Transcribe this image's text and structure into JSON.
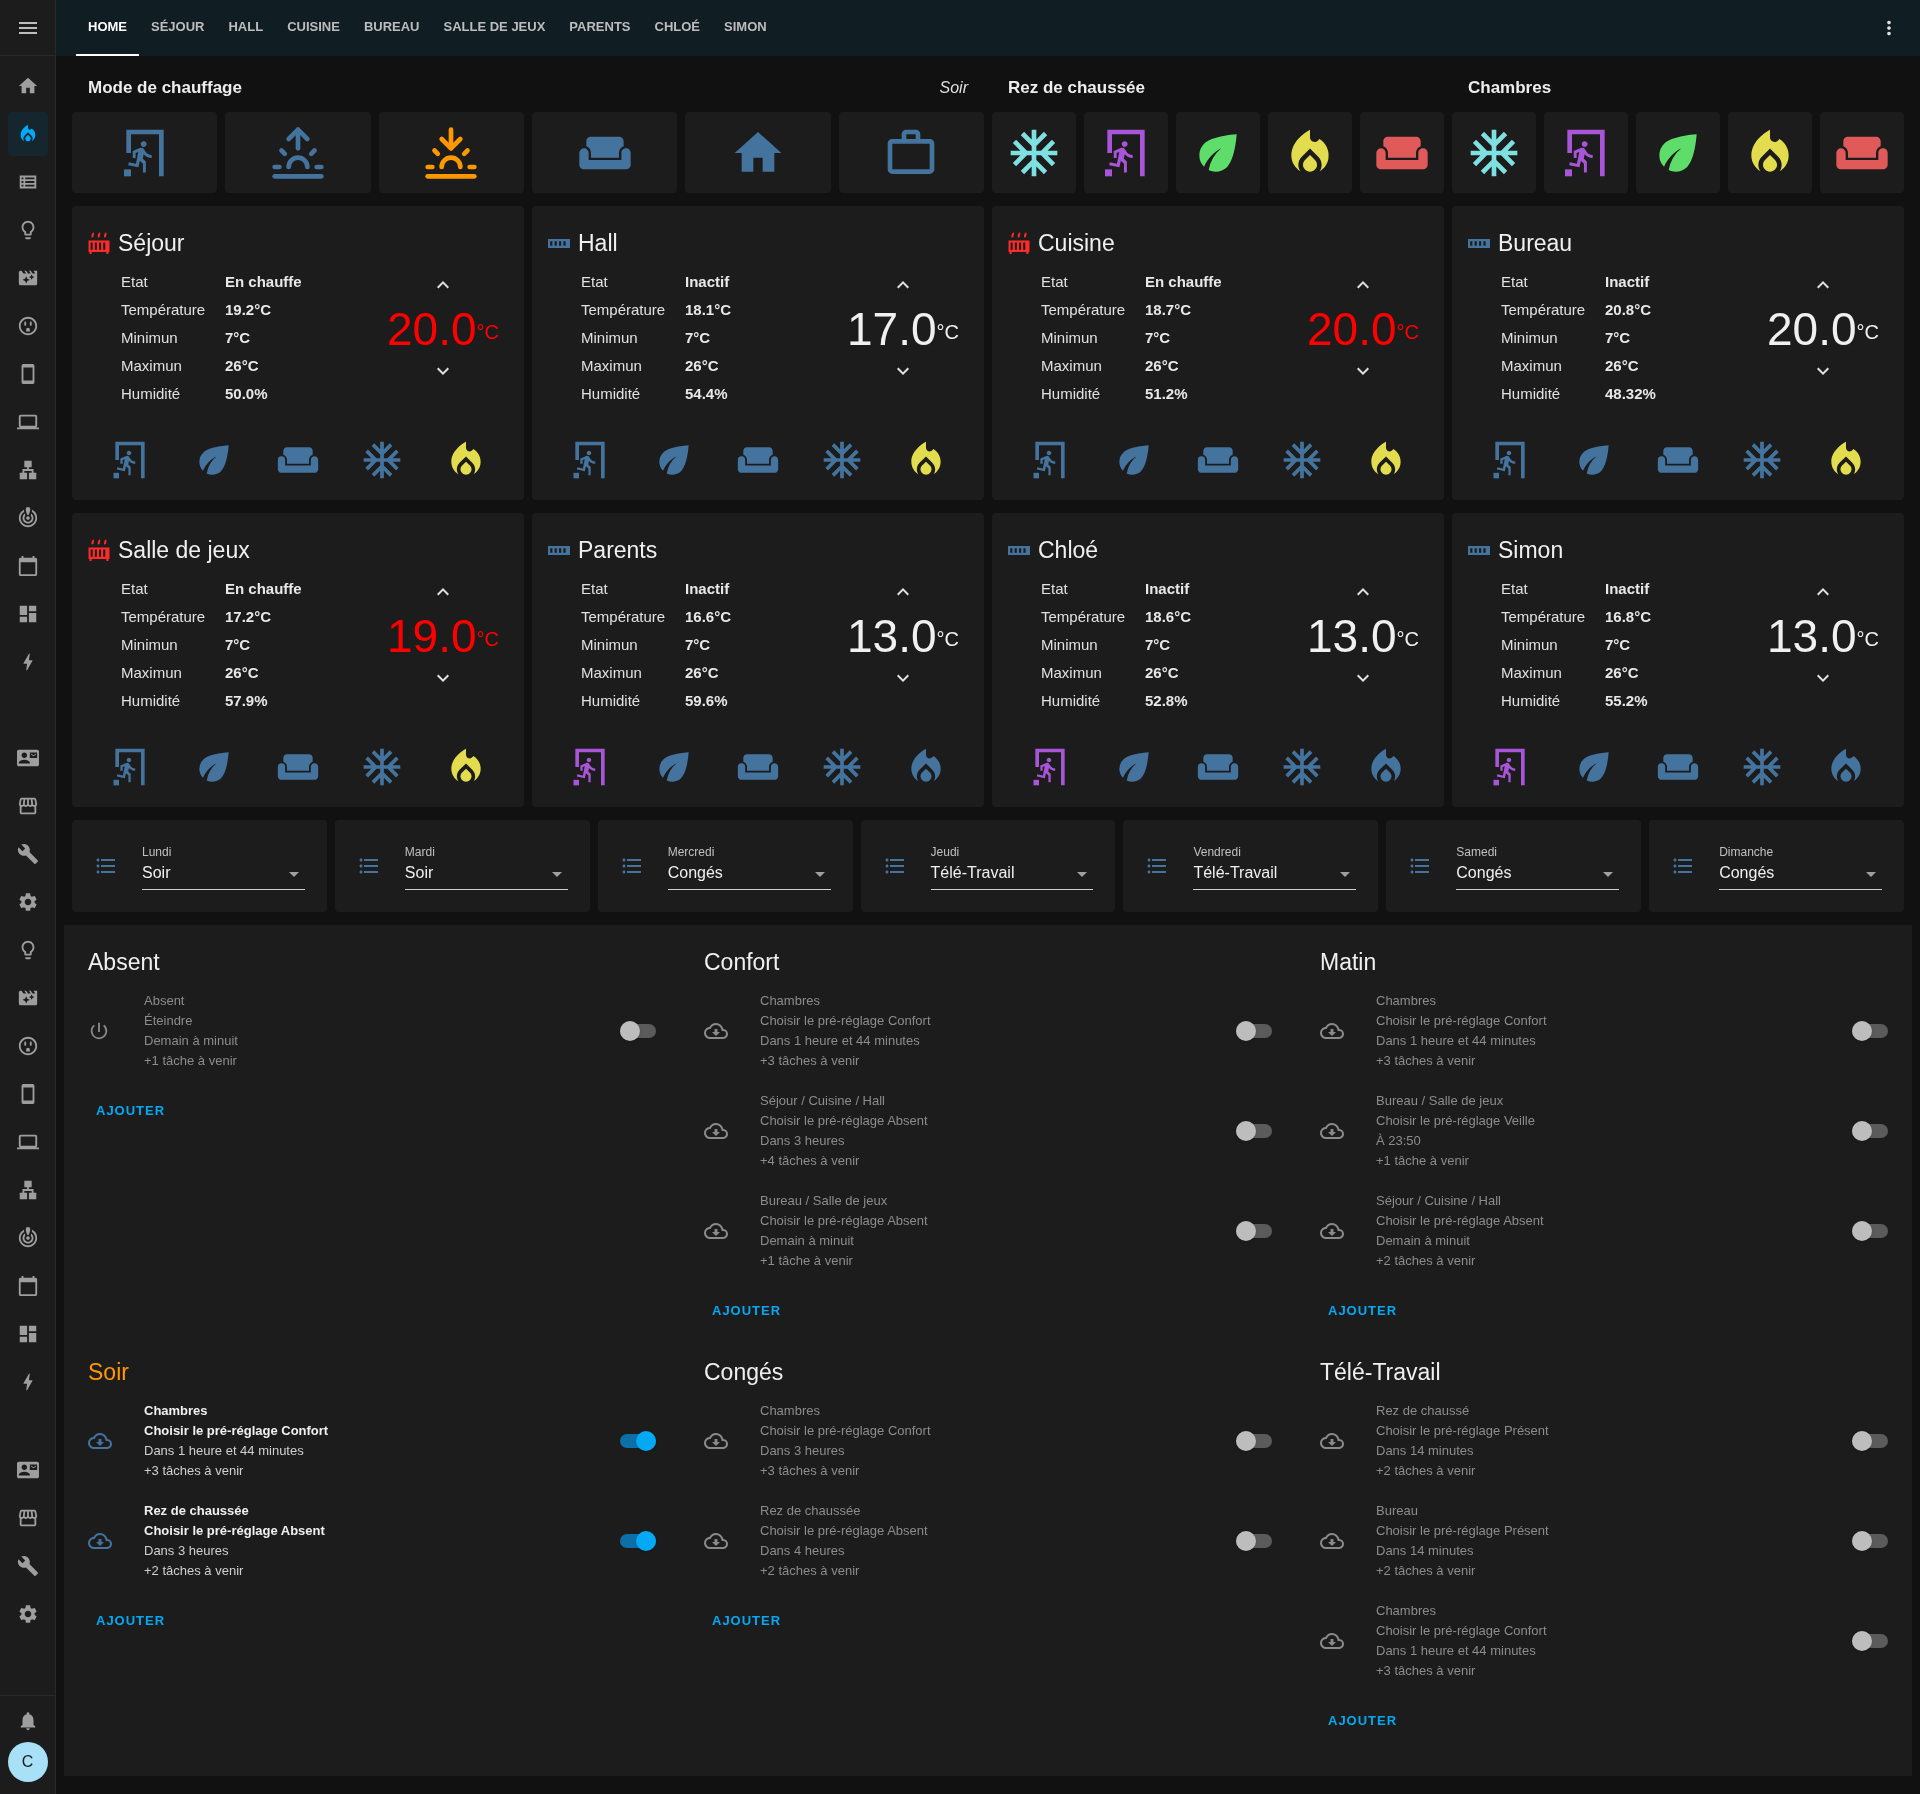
{
  "top_bar": {
    "tabs": [
      {
        "label": "HOME",
        "selected": true
      },
      {
        "label": "SÉJOUR",
        "selected": false
      },
      {
        "label": "HALL",
        "selected": false
      },
      {
        "label": "CUISINE",
        "selected": false
      },
      {
        "label": "BUREAU",
        "selected": false
      },
      {
        "label": "SALLE DE JEUX",
        "selected": false
      },
      {
        "label": "PARENTS",
        "selected": false
      },
      {
        "label": "CHLOÉ",
        "selected": false
      },
      {
        "label": "SIMON",
        "selected": false
      }
    ]
  },
  "sidebar": {
    "sections": [
      {
        "items": [
          {
            "selected": false
          },
          {
            "selected": true
          },
          {
            "selected": false
          },
          {
            "selected": false
          },
          {
            "selected": false
          },
          {
            "selected": false
          },
          {
            "selected": false
          },
          {
            "selected": false
          },
          {
            "selected": false
          },
          {
            "selected": false
          },
          {
            "selected": false
          },
          {
            "selected": false
          },
          {
            "selected": false
          }
        ]
      },
      {
        "items": [
          {
            "selected": false
          },
          {
            "selected": false
          },
          {
            "selected": false
          },
          {
            "selected": false
          },
          {
            "selected": false
          },
          {
            "selected": false
          },
          {
            "selected": false
          },
          {
            "selected": false
          },
          {
            "selected": false
          },
          {
            "selected": false
          },
          {
            "selected": false
          },
          {
            "selected": false
          },
          {
            "selected": false
          },
          {
            "selected": false
          }
        ]
      },
      {
        "items": [
          {
            "selected": false
          },
          {
            "selected": false
          },
          {
            "selected": false
          },
          {
            "selected": false
          }
        ]
      }
    ],
    "avatar": "C"
  },
  "mode_groups": [
    {
      "title": "Mode de chauffage",
      "subtitle": "Soir",
      "buttons": [
        {
          "kind": "away",
          "color": "#44739e"
        },
        {
          "kind": "sun-up",
          "color": "#44739e"
        },
        {
          "kind": "sun-down",
          "color": "#ff9800"
        },
        {
          "kind": "comfort",
          "color": "#44739e"
        },
        {
          "kind": "home",
          "color": "#44739e"
        },
        {
          "kind": "work",
          "color": "#44739e"
        }
      ]
    },
    {
      "title": "Rez de chaussée",
      "buttons": [
        {
          "kind": "frost",
          "color": "#7ee0e0"
        },
        {
          "kind": "away",
          "color": "#a855d8"
        },
        {
          "kind": "eco",
          "color": "#5fdd6b"
        },
        {
          "kind": "heat",
          "color": "#e3dc4f"
        },
        {
          "kind": "comfort",
          "color": "#e05a5a"
        }
      ]
    },
    {
      "title": "Chambres",
      "buttons": [
        {
          "kind": "frost",
          "color": "#7ee0e0"
        },
        {
          "kind": "away",
          "color": "#a855d8"
        },
        {
          "kind": "eco",
          "color": "#5fdd6b"
        },
        {
          "kind": "heat",
          "color": "#e3dc4f"
        },
        {
          "kind": "comfort",
          "color": "#e05a5a"
        }
      ]
    }
  ],
  "thermostats": [
    {
      "name": "Séjour",
      "heating": true,
      "attributes": [
        {
          "label": "Etat",
          "value": "En chauffe"
        },
        {
          "label": "Température",
          "value": "19.2°C"
        },
        {
          "label": "Minimun",
          "value": "7°C"
        },
        {
          "label": "Maximun",
          "value": "26°C"
        },
        {
          "label": "Humidité",
          "value": "50.0%"
        }
      ],
      "target": "20.0",
      "unit": "°C",
      "presets": [
        {
          "kind": "away",
          "color": "#44739e"
        },
        {
          "kind": "eco",
          "color": "#44739e"
        },
        {
          "kind": "comfort",
          "color": "#44739e"
        },
        {
          "kind": "frost",
          "color": "#44739e"
        },
        {
          "kind": "heat",
          "color": "#e3dc4f"
        }
      ]
    },
    {
      "name": "Hall",
      "heating": false,
      "attributes": [
        {
          "label": "Etat",
          "value": "Inactif"
        },
        {
          "label": "Température",
          "value": "18.1°C"
        },
        {
          "label": "Minimun",
          "value": "7°C"
        },
        {
          "label": "Maximun",
          "value": "26°C"
        },
        {
          "label": "Humidité",
          "value": "54.4%"
        }
      ],
      "target": "17.0",
      "unit": "°C",
      "presets": [
        {
          "kind": "away",
          "color": "#44739e"
        },
        {
          "kind": "eco",
          "color": "#44739e"
        },
        {
          "kind": "comfort",
          "color": "#44739e"
        },
        {
          "kind": "frost",
          "color": "#44739e"
        },
        {
          "kind": "heat",
          "color": "#e3dc4f"
        }
      ]
    },
    {
      "name": "Cuisine",
      "heating": true,
      "attributes": [
        {
          "label": "Etat",
          "value": "En chauffe"
        },
        {
          "label": "Température",
          "value": "18.7°C"
        },
        {
          "label": "Minimun",
          "value": "7°C"
        },
        {
          "label": "Maximun",
          "value": "26°C"
        },
        {
          "label": "Humidité",
          "value": "51.2%"
        }
      ],
      "target": "20.0",
      "unit": "°C",
      "presets": [
        {
          "kind": "away",
          "color": "#44739e"
        },
        {
          "kind": "eco",
          "color": "#44739e"
        },
        {
          "kind": "comfort",
          "color": "#44739e"
        },
        {
          "kind": "frost",
          "color": "#44739e"
        },
        {
          "kind": "heat",
          "color": "#e3dc4f"
        }
      ]
    },
    {
      "name": "Bureau",
      "heating": false,
      "attributes": [
        {
          "label": "Etat",
          "value": "Inactif"
        },
        {
          "label": "Température",
          "value": "20.8°C"
        },
        {
          "label": "Minimun",
          "value": "7°C"
        },
        {
          "label": "Maximun",
          "value": "26°C"
        },
        {
          "label": "Humidité",
          "value": "48.32%"
        }
      ],
      "target": "20.0",
      "unit": "°C",
      "presets": [
        {
          "kind": "away",
          "color": "#44739e"
        },
        {
          "kind": "eco",
          "color": "#44739e"
        },
        {
          "kind": "comfort",
          "color": "#44739e"
        },
        {
          "kind": "frost",
          "color": "#44739e"
        },
        {
          "kind": "heat",
          "color": "#e3dc4f"
        }
      ]
    },
    {
      "name": "Salle de jeux",
      "heating": true,
      "attributes": [
        {
          "label": "Etat",
          "value": "En chauffe"
        },
        {
          "label": "Température",
          "value": "17.2°C"
        },
        {
          "label": "Minimun",
          "value": "7°C"
        },
        {
          "label": "Maximun",
          "value": "26°C"
        },
        {
          "label": "Humidité",
          "value": "57.9%"
        }
      ],
      "target": "19.0",
      "unit": "°C",
      "presets": [
        {
          "kind": "away",
          "color": "#44739e"
        },
        {
          "kind": "eco",
          "color": "#44739e"
        },
        {
          "kind": "comfort",
          "color": "#44739e"
        },
        {
          "kind": "frost",
          "color": "#44739e"
        },
        {
          "kind": "heat",
          "color": "#e3dc4f"
        }
      ]
    },
    {
      "name": "Parents",
      "heating": false,
      "attributes": [
        {
          "label": "Etat",
          "value": "Inactif"
        },
        {
          "label": "Température",
          "value": "16.6°C"
        },
        {
          "label": "Minimun",
          "value": "7°C"
        },
        {
          "label": "Maximun",
          "value": "26°C"
        },
        {
          "label": "Humidité",
          "value": "59.6%"
        }
      ],
      "target": "13.0",
      "unit": "°C",
      "presets": [
        {
          "kind": "away",
          "color": "#a855d8"
        },
        {
          "kind": "eco",
          "color": "#44739e"
        },
        {
          "kind": "comfort",
          "color": "#44739e"
        },
        {
          "kind": "frost",
          "color": "#44739e"
        },
        {
          "kind": "heat",
          "color": "#44739e"
        }
      ]
    },
    {
      "name": "Chloé",
      "heating": false,
      "attributes": [
        {
          "label": "Etat",
          "value": "Inactif"
        },
        {
          "label": "Température",
          "value": "18.6°C"
        },
        {
          "label": "Minimun",
          "value": "7°C"
        },
        {
          "label": "Maximun",
          "value": "26°C"
        },
        {
          "label": "Humidité",
          "value": "52.8%"
        }
      ],
      "target": "13.0",
      "unit": "°C",
      "presets": [
        {
          "kind": "away",
          "color": "#a855d8"
        },
        {
          "kind": "eco",
          "color": "#44739e"
        },
        {
          "kind": "comfort",
          "color": "#44739e"
        },
        {
          "kind": "frost",
          "color": "#44739e"
        },
        {
          "kind": "heat",
          "color": "#44739e"
        }
      ]
    },
    {
      "name": "Simon",
      "heating": false,
      "attributes": [
        {
          "label": "Etat",
          "value": "Inactif"
        },
        {
          "label": "Température",
          "value": "16.8°C"
        },
        {
          "label": "Minimun",
          "value": "7°C"
        },
        {
          "label": "Maximun",
          "value": "26°C"
        },
        {
          "label": "Humidité",
          "value": "55.2%"
        }
      ],
      "target": "13.0",
      "unit": "°C",
      "presets": [
        {
          "kind": "away",
          "color": "#a855d8"
        },
        {
          "kind": "eco",
          "color": "#44739e"
        },
        {
          "kind": "comfort",
          "color": "#44739e"
        },
        {
          "kind": "frost",
          "color": "#44739e"
        },
        {
          "kind": "heat",
          "color": "#44739e"
        }
      ]
    }
  ],
  "day_selectors": [
    {
      "label": "Lundi",
      "value": "Soir"
    },
    {
      "label": "Mardi",
      "value": "Soir"
    },
    {
      "label": "Mercredi",
      "value": "Congés"
    },
    {
      "label": "Jeudi",
      "value": "Télé-Travail"
    },
    {
      "label": "Vendredi",
      "value": "Télé-Travail"
    },
    {
      "label": "Samedi",
      "value": "Congés"
    },
    {
      "label": "Dimanche",
      "value": "Congés"
    }
  ],
  "schedules": [
    {
      "title": "Absent",
      "selected": false,
      "add_label": "AJOUTER",
      "entries": [
        {
          "kind": "power",
          "on": false,
          "lines": [
            "Absent",
            "Éteindre",
            "Demain à minuit",
            "+1 tâche à venir"
          ]
        }
      ]
    },
    {
      "title": "Confort",
      "selected": false,
      "add_label": "AJOUTER",
      "entries": [
        {
          "kind": "cloud",
          "on": false,
          "lines": [
            "Chambres",
            "Choisir le pré-réglage Confort",
            "Dans 1 heure et 44 minutes",
            "+3 tâches à venir"
          ]
        },
        {
          "kind": "cloud",
          "on": false,
          "lines": [
            "Séjour / Cuisine / Hall",
            "Choisir le pré-réglage Absent",
            "Dans 3 heures",
            "+4 tâches à venir"
          ]
        },
        {
          "kind": "cloud",
          "on": false,
          "lines": [
            "Bureau / Salle de jeux",
            "Choisir le pré-réglage Absent",
            "Demain à minuit",
            "+1 tâche à venir"
          ]
        }
      ]
    },
    {
      "title": "Matin",
      "selected": false,
      "add_label": "AJOUTER",
      "entries": [
        {
          "kind": "cloud",
          "on": false,
          "lines": [
            "Chambres",
            "Choisir le pré-réglage Confort",
            "Dans 1 heure et 44 minutes",
            "+3 tâches à venir"
          ]
        },
        {
          "kind": "cloud",
          "on": false,
          "lines": [
            "Bureau / Salle de jeux",
            "Choisir le pré-réglage Veille",
            "À 23:50",
            "+1 tâche à venir"
          ]
        },
        {
          "kind": "cloud",
          "on": false,
          "lines": [
            "Séjour / Cuisine / Hall",
            "Choisir le pré-réglage Absent",
            "Demain à minuit",
            "+2 tâches à venir"
          ]
        }
      ]
    },
    {
      "title": "Soir",
      "selected": true,
      "add_label": "AJOUTER",
      "entries": [
        {
          "kind": "cloud",
          "on": true,
          "lines": [
            "Chambres",
            "Choisir le pré-réglage Confort",
            "Dans 1 heure et 44 minutes",
            "+3 tâches à venir"
          ]
        },
        {
          "kind": "cloud",
          "on": true,
          "lines": [
            "Rez de chaussée",
            "Choisir le pré-réglage Absent",
            "Dans 3 heures",
            "+2 tâches à venir"
          ]
        }
      ]
    },
    {
      "title": "Congés",
      "selected": false,
      "add_label": "AJOUTER",
      "entries": [
        {
          "kind": "cloud",
          "on": false,
          "lines": [
            "Chambres",
            "Choisir le pré-réglage Confort",
            "Dans 3 heures",
            "+3 tâches à venir"
          ]
        },
        {
          "kind": "cloud",
          "on": false,
          "lines": [
            "Rez de chaussée",
            "Choisir le pré-réglage Absent",
            "Dans 4 heures",
            "+2 tâches à venir"
          ]
        }
      ]
    },
    {
      "title": "Télé-Travail",
      "selected": false,
      "add_label": "AJOUTER",
      "entries": [
        {
          "kind": "cloud",
          "on": false,
          "lines": [
            "Rez de chaussé",
            "Choisir le pré-réglage Présent",
            "Dans 14 minutes",
            "+2 tâches à venir"
          ]
        },
        {
          "kind": "cloud",
          "on": false,
          "lines": [
            "Bureau",
            "Choisir le pré-réglage Présent",
            "Dans 14 minutes",
            "+2 tâches à venir"
          ]
        },
        {
          "kind": "cloud",
          "on": false,
          "lines": [
            "Chambres",
            "Choisir le pré-réglage Confort",
            "Dans 1 heure et 44 minutes",
            "+3 tâches à venir"
          ]
        }
      ]
    }
  ]
}
